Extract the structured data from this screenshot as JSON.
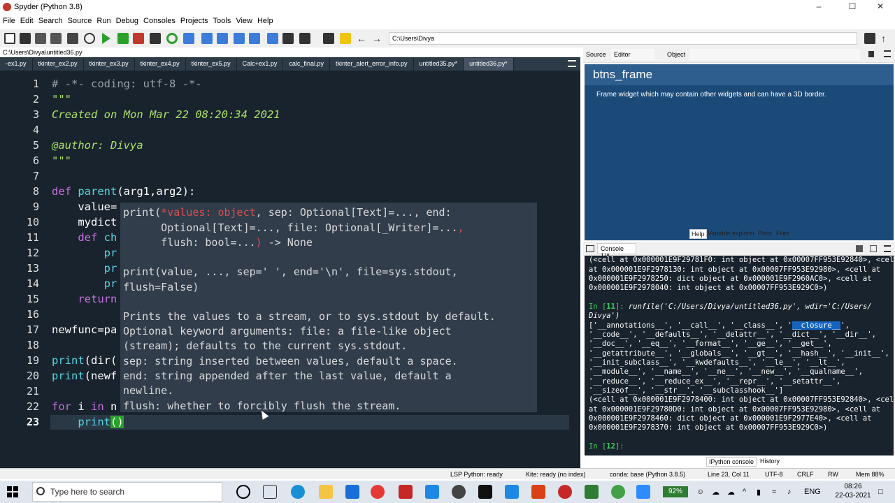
{
  "window": {
    "title": "Spyder (Python 3.8)",
    "minimize": "–",
    "maximize": "☐",
    "close": "✕"
  },
  "menu": [
    "File",
    "Edit",
    "Search",
    "Source",
    "Run",
    "Debug",
    "Consoles",
    "Projects",
    "Tools",
    "View",
    "Help"
  ],
  "toolbar": {
    "path": "C:\\Users\\Divya"
  },
  "editor": {
    "filepath": "C:\\Users\\Divya\\untitled36.py",
    "tabs": [
      "-ex1.py",
      "tkinter_ex2.py",
      "tkinter_ex3.py",
      "tkinter_ex4.py",
      "tkinter_ex5.py",
      "Calc+ex1.py",
      "calc_final.py",
      "tkinter_alert_error_info.py",
      "untitled35.py*",
      "untitled36.py*"
    ],
    "active_tab": "untitled36.py*",
    "line_numbers": [
      "1",
      "2",
      "3",
      "4",
      "5",
      "6",
      "7",
      "8",
      "9",
      "10",
      "11",
      "12",
      "13",
      "14",
      "15",
      "16",
      "17",
      "18",
      "19",
      "20",
      "21",
      "22",
      "23"
    ],
    "lines": {
      "l1": "# -*- coding: utf-8 -*-",
      "l2": "\"\"\"",
      "l3": "Created on Mon Mar 22 08:20:34 2021",
      "l5": "@author: Divya",
      "l6": "\"\"\"",
      "l8_kw": "def ",
      "l8_fn": "parent",
      "l8_rest": "(arg1,arg2):",
      "l9": "    value=",
      "l10": "    mydict",
      "l11_kw": "    def ",
      "l11_rest": "ch",
      "l12": "        pr",
      "l13": "        pr",
      "l14": "        pr",
      "l15_kw": "    return",
      "l17": "newfunc=pa",
      "l19_fn": "print",
      "l19_rest": "(dir(",
      "l20_fn": "print",
      "l20_rest": "(newf",
      "l22_kw": "for ",
      "l22_rest": "i ",
      "l22_kw2": "in ",
      "l22_rest2": "n",
      "l23_fn": "    print",
      "l23_rest": "()"
    }
  },
  "tooltip": {
    "s1a": "print(",
    "s1b": "*values: object",
    "s1c": ", sep: Optional[Text]=...",
    "s1d": ", end:",
    "s2a": "      Optional[Text]=...",
    "s2b": ", file: Optional[_Writer]=...",
    "s2c": ",",
    "s3a": "      flush: bool=...",
    "s3b": ")",
    "s3c": " -> None",
    "s4": "print(value, ..., sep=' ', end='\\n', file=sys.stdout,",
    "s5": "flush=False)",
    "d1": "Prints the values to a stream, or to sys.stdout by default.",
    "d2": "Optional keyword arguments: file: a file-like object",
    "d3": "(stream); defaults to the current sys.stdout.",
    "d4": "sep: string inserted between values, default a space.",
    "d5": "end: string appended after the last value, default a",
    "d6": "newline.",
    "d7": "flush: whether to forcibly flush the stream."
  },
  "help": {
    "source_label": "Source",
    "source_value": "Editor",
    "object_label": "Object",
    "title": "btns_frame",
    "text": "Frame widget which may contain other widgets and can have a 3D border.",
    "tabs": [
      "Help",
      "Variable explorer",
      "Plots",
      "Files"
    ]
  },
  "console": {
    "tab": "Console 1/A",
    "lines": {
      "c1": "(<cell at 0x000001E9F29781F0: int object at 0x00007FF953E92840>, <cell",
      "c2": "at 0x000001E9F2978130: int object at 0x00007FF953E92980>, <cell at",
      "c3": "0x000001E9F2978250: dict object at 0x000001E9F2960AC0>, <cell at",
      "c4": "0x000001E9F2978040: int object at 0x00007FF953E929C0>)",
      "c6a": "In [",
      "c6b": "11",
      "c6c": "]: ",
      "c6d": "runfile('C:/Users/Divya/untitled36.py', wdir='C:/Users/",
      "c7": "Divya')",
      "c8a": "['__annotations__', '__call__', '__class__', '",
      "c8b": "__closure__",
      "c8c": "',",
      "c9": "'__code__', '__defaults__', '__delattr__', '__dict__', '__dir__',",
      "c10": "'__doc__', '__eq__', '__format__', '__ge__', '__get__',",
      "c11": "'__getattribute__', '__globals__', '__gt__', '__hash__', '__init__',",
      "c12": "'__init_subclass__', '__kwdefaults__', '__le__', '__lt__',",
      "c13": "'__module__', '__name__', '__ne__', '__new__', '__qualname__',",
      "c14": "'__reduce__', '__reduce_ex__', '__repr__', '__setattr__',",
      "c15": "'__sizeof__', '__str__', '__subclasshook__']",
      "c16": "(<cell at 0x000001E9F2978400: int object at 0x00007FF953E92840>, <cell",
      "c17": "at 0x000001E9F29780D0: int object at 0x00007FF953E92980>, <cell at",
      "c18": "0x000001E9F2978460: dict object at 0x000001E9F2977E40>, <cell at",
      "c19": "0x000001E9F2978370: int object at 0x00007FF953E929C0>)",
      "c21a": "In [",
      "c21b": "12",
      "c21c": "]:"
    },
    "bottom_tabs": [
      "IPython console",
      "History"
    ]
  },
  "statusbar": {
    "lsp": "LSP Python: ready",
    "kite": "Kite: ready (no index)",
    "conda": "conda: base (Python 3.8.5)",
    "position": "Line 23, Col 11",
    "encoding": "UTF-8",
    "eol": "CRLF",
    "rw": "RW",
    "mem": "Mem 88%"
  },
  "taskbar": {
    "search_placeholder": "Type here to search",
    "battery": "92%",
    "lang": "ENG",
    "time": "08:26",
    "date": "22-03-2021"
  }
}
